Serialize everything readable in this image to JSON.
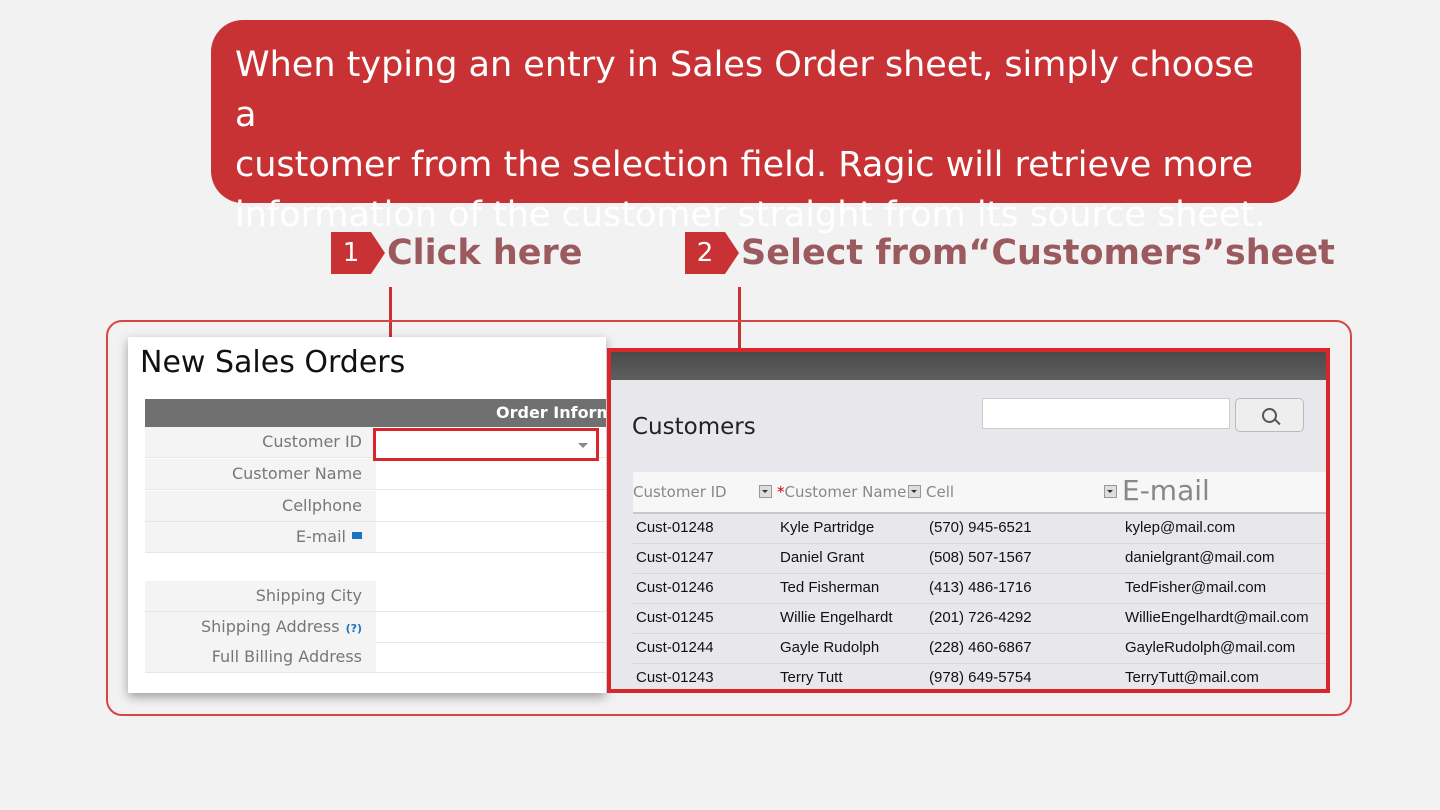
{
  "callout": {
    "line1": "When typing an entry in Sales Order sheet, simply choose a",
    "line2": "customer from the selection field. Ragic will retrieve more",
    "line3": "information of the customer straight from its source sheet."
  },
  "steps": [
    {
      "number": "1",
      "label": "Click here"
    },
    {
      "number": "2",
      "label": "Select from“Customers”sheet"
    }
  ],
  "sales_form": {
    "title": "New Sales Orders",
    "section": "Order Information",
    "fields": [
      {
        "label": "Customer ID",
        "value": ""
      },
      {
        "label": "Customer Name",
        "value": ""
      },
      {
        "label": "Cellphone",
        "value": ""
      },
      {
        "label": "E-mail",
        "value": ""
      },
      {
        "label": "Shipping City",
        "value": ""
      },
      {
        "label": "Shipping Address",
        "help": "(?)",
        "value": ""
      },
      {
        "label": "Full Billing Address",
        "value": ""
      }
    ]
  },
  "customers": {
    "title": "Customers",
    "search_value": "",
    "columns": [
      "Customer ID",
      "Customer Name",
      "Cell",
      "E-mail"
    ],
    "required_mark": "*",
    "rows": [
      [
        "Cust-01248",
        "Kyle Partridge",
        "(570) 945-6521",
        "kylep@mail.com"
      ],
      [
        "Cust-01247",
        "Daniel Grant",
        "(508) 507-1567",
        "danielgrant@mail.com"
      ],
      [
        "Cust-01246",
        "Ted Fisherman",
        "(413) 486-1716",
        "TedFisher@mail.com"
      ],
      [
        "Cust-01245",
        "Willie Engelhardt",
        "(201) 726-4292",
        "WillieEngelhardt@mail.com"
      ],
      [
        "Cust-01244",
        "Gayle Rudolph",
        "(228) 460-6867",
        "GayleRudolph@mail.com"
      ],
      [
        "Cust-01243",
        "Terry Tutt",
        "(978) 649-5754",
        "TerryTutt@mail.com"
      ]
    ]
  },
  "colors": {
    "accent": "#c93234",
    "highlight": "#d9262b",
    "step_text": "#9a5a5e"
  }
}
